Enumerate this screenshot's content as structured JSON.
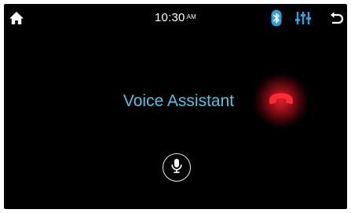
{
  "status_bar": {
    "time": "10:30",
    "ampm": "AM",
    "icons": {
      "home": "home-icon",
      "bluetooth": "bluetooth-icon",
      "equalizer": "equalizer-icon",
      "back": "back-icon"
    }
  },
  "main": {
    "title": "Voice Assistant",
    "end_call_icon": "phone-hangup-icon",
    "mic_icon": "microphone-icon"
  },
  "colors": {
    "background": "#000000",
    "title": "#55c2de",
    "accent": "#2f9fe0",
    "hangup": "#e8232d"
  }
}
